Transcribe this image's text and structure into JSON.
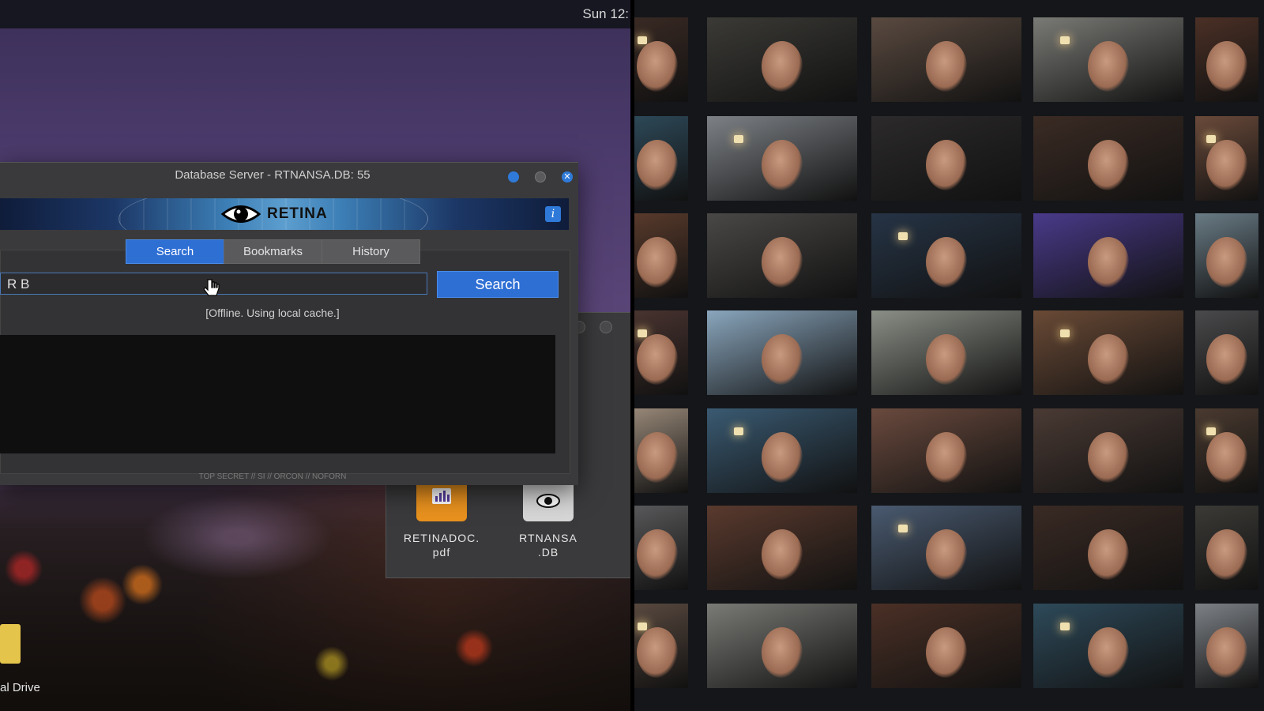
{
  "topbar": {
    "clock": "Sun 12:"
  },
  "window": {
    "title": "Database Server - RTNANSA.DB: 55",
    "brand": "RETINA",
    "info_label": "i",
    "tabs": [
      {
        "label": "Search",
        "active": true
      },
      {
        "label": "Bookmarks",
        "active": false
      },
      {
        "label": "History",
        "active": false
      }
    ],
    "search_value": "R B",
    "search_button": "Search",
    "status": "[Offline. Using local cache.]",
    "classification": "TOP SECRET // SI // ORCON // NOFORN"
  },
  "files": [
    {
      "name_line1": "RETINADOC.",
      "name_line2": "pdf",
      "icon": "chart-document-icon"
    },
    {
      "name_line1": "RTNANSA",
      "name_line2": ".DB",
      "icon": "eye-document-icon"
    }
  ],
  "desktop": {
    "drive_label": "al Drive"
  },
  "colors": {
    "accent": "#2e6fd4",
    "window_bg": "#3a3a3c",
    "pdf_icon": "#e8911e"
  },
  "mosaic": {
    "tiles": [
      {
        "bg": "#3a2a24"
      },
      {
        "bg": "#3b3a36"
      },
      {
        "bg": "#5a4a40"
      },
      {
        "bg": "#7a7a76"
      },
      {
        "bg": "#4b3026"
      },
      {
        "bg": "#2e4a5a"
      },
      {
        "bg": "#7d8186"
      },
      {
        "bg": "#2c2a2a"
      },
      {
        "bg": "#3b2b24"
      },
      {
        "bg": "#6a4a3a"
      },
      {
        "bg": "#5a3b2c"
      },
      {
        "bg": "#4a4846"
      },
      {
        "bg": "#263446"
      },
      {
        "bg": "#4a3a8a"
      },
      {
        "bg": "#6a7c86"
      },
      {
        "bg": "#4a3430"
      },
      {
        "bg": "#8aa6bd"
      },
      {
        "bg": "#8a8f86"
      },
      {
        "bg": "#6a4a36"
      },
      {
        "bg": "#4a4a4c"
      },
      {
        "bg": "#9a8a7a"
      },
      {
        "bg": "#3a5a72"
      },
      {
        "bg": "#6a4a3e"
      },
      {
        "bg": "#4a3a34"
      },
      {
        "bg": "#4a3a30"
      },
      {
        "bg": "#5a5a5c"
      },
      {
        "bg": "#5a3a2e"
      },
      {
        "bg": "#4a5a70"
      }
    ]
  }
}
